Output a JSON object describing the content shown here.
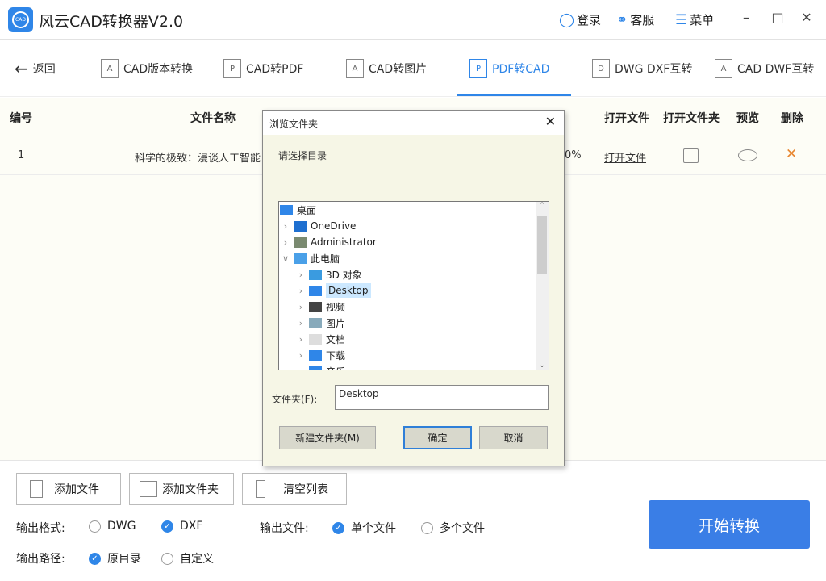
{
  "app": {
    "title": "风云CAD转换器V2.0",
    "login": "登录",
    "service": "客服",
    "menu": "菜单",
    "logo_text": "CAD"
  },
  "nav": {
    "back": "返回",
    "tabs": [
      {
        "label": "CAD版本转换",
        "icon": "A"
      },
      {
        "label": "CAD转PDF",
        "icon": "P"
      },
      {
        "label": "CAD转图片",
        "icon": "A"
      },
      {
        "label": "PDF转CAD",
        "icon": "P",
        "active": true
      },
      {
        "label": "DWG DXF互转",
        "icon": "D"
      },
      {
        "label": "CAD DWF互转",
        "icon": "A"
      }
    ]
  },
  "table": {
    "headers": [
      "编号",
      "文件名称",
      "打开文件",
      "打开文件夹",
      "预览",
      "删除"
    ],
    "rows": [
      {
        "index": "1",
        "name": "科学的极致：漫谈人工智能",
        "progress": "0%",
        "open": "打开文件"
      }
    ]
  },
  "actions": {
    "add_file": "添加文件",
    "add_folder": "添加文件夹",
    "clear": "清空列表",
    "start": "开始转换"
  },
  "options": {
    "format_label": "输出格式:",
    "format_options": [
      "DWG",
      "DXF"
    ],
    "format_selected": "DXF",
    "file_label": "输出文件:",
    "file_options": [
      "单个文件",
      "多个文件"
    ],
    "file_selected": "单个文件",
    "path_label": "输出路径:",
    "path_options": [
      "原目录",
      "自定义"
    ],
    "path_selected": "原目录"
  },
  "dialog": {
    "title": "浏览文件夹",
    "prompt": "请选择目录",
    "tree": [
      {
        "label": "桌面",
        "level": 0,
        "chev": ""
      },
      {
        "label": "OneDrive",
        "level": 1,
        "chev": ">"
      },
      {
        "label": "Administrator",
        "level": 1,
        "chev": ">"
      },
      {
        "label": "此电脑",
        "level": 1,
        "chev": "v"
      },
      {
        "label": "3D 对象",
        "level": 2,
        "chev": ">"
      },
      {
        "label": "Desktop",
        "level": 2,
        "chev": ">",
        "selected": true
      },
      {
        "label": "视频",
        "level": 2,
        "chev": ">"
      },
      {
        "label": "图片",
        "level": 2,
        "chev": ">"
      },
      {
        "label": "文档",
        "level": 2,
        "chev": ">"
      },
      {
        "label": "下载",
        "level": 2,
        "chev": ">"
      },
      {
        "label": "音乐",
        "level": 2,
        "chev": ">"
      }
    ],
    "folder_label": "文件夹(F):",
    "folder_value": "Desktop",
    "new_folder": "新建文件夹(M)",
    "ok": "确定",
    "cancel": "取消"
  },
  "colors": {
    "accent": "#2f86e8",
    "delete": "#e8862f"
  }
}
